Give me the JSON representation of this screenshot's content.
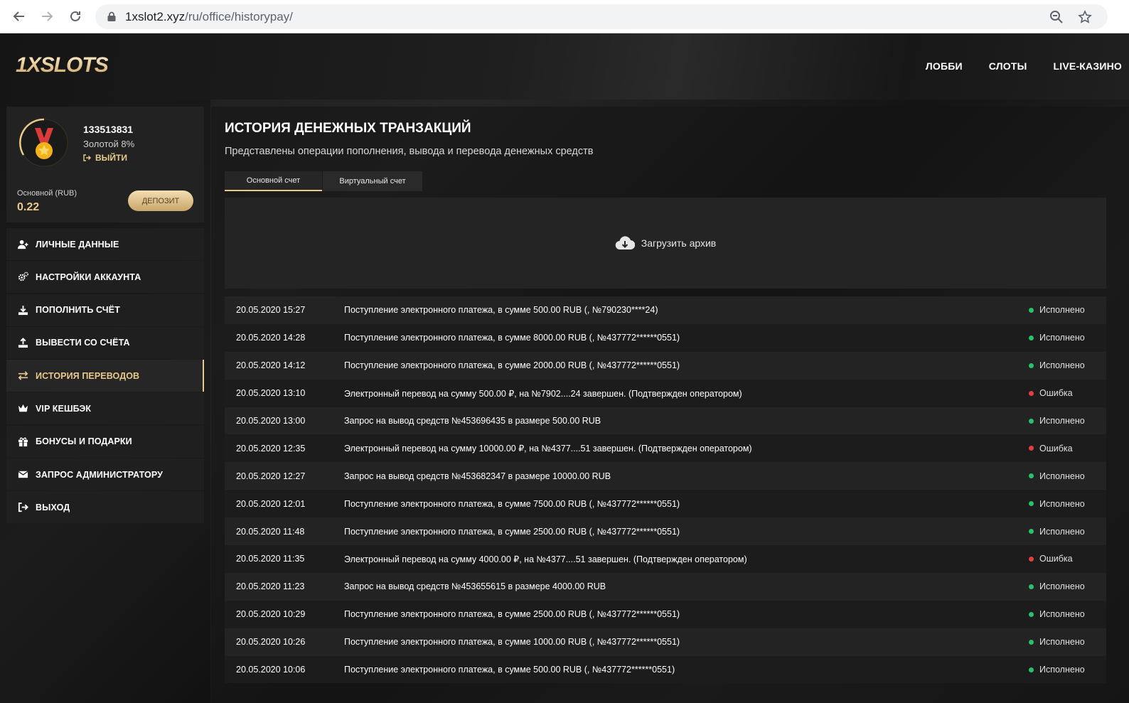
{
  "browser": {
    "url_domain": "1xslot2.xyz",
    "url_path": "/ru/office/historypay/"
  },
  "site": {
    "logo": "1XSLOTS",
    "nav": [
      "ЛОББИ",
      "СЛОТЫ",
      "LIVE-КАЗИНО"
    ]
  },
  "profile": {
    "user_id": "133513831",
    "level": "Золотой 8%",
    "logout": "ВЫЙТИ",
    "balance_label": "Основной (RUB)",
    "balance_value": "0.22",
    "deposit": "ДЕПОЗИТ"
  },
  "menu": [
    {
      "label": "ЛИЧНЫЕ ДАННЫЕ",
      "icon": "user-plus-icon"
    },
    {
      "label": "НАСТРОЙКИ АККАУНТА",
      "icon": "gears-icon"
    },
    {
      "label": "ПОПОЛНИТЬ СЧЁТ",
      "icon": "download-icon"
    },
    {
      "label": "ВЫВЕСТИ СО СЧЁТА",
      "icon": "upload-icon"
    },
    {
      "label": "ИСТОРИЯ ПЕРЕВОДОВ",
      "icon": "transfer-arrows-icon",
      "active": true
    },
    {
      "label": "VIP КЕШБЭК",
      "icon": "crown-icon"
    },
    {
      "label": "БОНУСЫ И ПОДАРКИ",
      "icon": "gift-icon"
    },
    {
      "label": "ЗАПРОС АДМИНИСТРАТОРУ",
      "icon": "envelope-icon"
    },
    {
      "label": "ВЫХОД",
      "icon": "sign-out-icon"
    }
  ],
  "main": {
    "title": "ИСТОРИЯ ДЕНЕЖНЫХ ТРАНЗАКЦИЙ",
    "subtitle": "Представлены операции пополнения, вывода и перевода денежных средств",
    "tabs": [
      "Основной счет",
      "Виртуальный счет"
    ],
    "archive": "Загрузить архив"
  },
  "colors": {
    "accent": "#e8c98a",
    "success": "#27c26b",
    "error": "#e53e3e"
  },
  "transactions": [
    {
      "date": "20.05.2020 15:27",
      "desc": "Поступление электронного платежа, в сумме 500.00 RUB (, №790230****24)",
      "status": "Исполнено",
      "ok": true
    },
    {
      "date": "20.05.2020 14:28",
      "desc": "Поступление электронного платежа, в сумме 8000.00 RUB (, №437772******0551)",
      "status": "Исполнено",
      "ok": true
    },
    {
      "date": "20.05.2020 14:12",
      "desc": "Поступление электронного платежа, в сумме 2000.00 RUB (, №437772******0551)",
      "status": "Исполнено",
      "ok": true
    },
    {
      "date": "20.05.2020 13:10",
      "desc": "Электронный перевод на сумму 500.00 ₽, на №7902....24 завершен. (Подтвержден оператором)",
      "status": "Ошибка",
      "ok": false
    },
    {
      "date": "20.05.2020 13:00",
      "desc": "Запрос на вывод средств №453696435 в размере 500.00 RUB",
      "status": "Исполнено",
      "ok": true
    },
    {
      "date": "20.05.2020 12:35",
      "desc": "Электронный перевод на сумму 10000.00 ₽, на №4377....51 завершен. (Подтвержден оператором)",
      "status": "Ошибка",
      "ok": false
    },
    {
      "date": "20.05.2020 12:27",
      "desc": "Запрос на вывод средств №453682347 в размере 10000.00 RUB",
      "status": "Исполнено",
      "ok": true
    },
    {
      "date": "20.05.2020 12:01",
      "desc": "Поступление электронного платежа, в сумме 7500.00 RUB (, №437772******0551)",
      "status": "Исполнено",
      "ok": true
    },
    {
      "date": "20.05.2020 11:48",
      "desc": "Поступление электронного платежа, в сумме 2500.00 RUB (, №437772******0551)",
      "status": "Исполнено",
      "ok": true
    },
    {
      "date": "20.05.2020 11:35",
      "desc": "Электронный перевод на сумму 4000.00 ₽, на №4377....51 завершен. (Подтвержден оператором)",
      "status": "Ошибка",
      "ok": false
    },
    {
      "date": "20.05.2020 11:23",
      "desc": "Запрос на вывод средств №453655615 в размере 4000.00 RUB",
      "status": "Исполнено",
      "ok": true
    },
    {
      "date": "20.05.2020 10:29",
      "desc": "Поступление электронного платежа, в сумме 2500.00 RUB (, №437772******0551)",
      "status": "Исполнено",
      "ok": true
    },
    {
      "date": "20.05.2020 10:26",
      "desc": "Поступление электронного платежа, в сумме 1000.00 RUB (, №437772******0551)",
      "status": "Исполнено",
      "ok": true
    },
    {
      "date": "20.05.2020 10:06",
      "desc": "Поступление электронного платежа, в сумме 500.00 RUB (, №437772******0551)",
      "status": "Исполнено",
      "ok": true
    }
  ]
}
